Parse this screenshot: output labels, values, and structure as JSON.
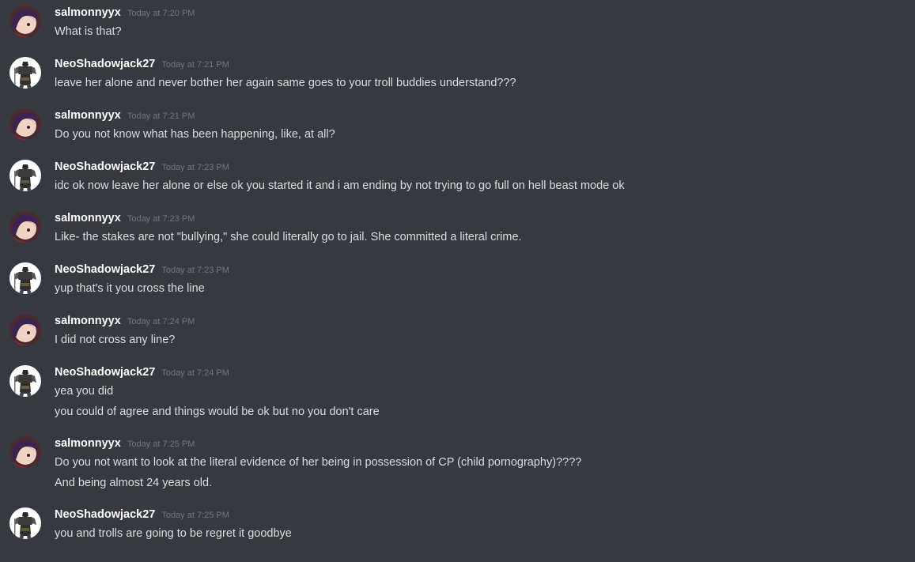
{
  "messages": [
    {
      "author": "salmonnyyx",
      "avatar": "anime-girl-avatar",
      "time": "Today at 7:20 PM",
      "lines": [
        "What is that?"
      ]
    },
    {
      "author": "NeoShadowjack27",
      "avatar": "dark-knight-avatar",
      "time": "Today at 7:21 PM",
      "lines": [
        "leave her alone and never bother her again same goes to your troll buddies understand???"
      ]
    },
    {
      "author": "salmonnyyx",
      "avatar": "anime-girl-avatar",
      "time": "Today at 7:21 PM",
      "lines": [
        "Do you not know what has been happening, like, at all?"
      ]
    },
    {
      "author": "NeoShadowjack27",
      "avatar": "dark-knight-avatar",
      "time": "Today at 7:23 PM",
      "lines": [
        "idc ok now leave her alone or else ok you started it and i am ending by not trying to go full on hell beast mode ok"
      ]
    },
    {
      "author": "salmonnyyx",
      "avatar": "anime-girl-avatar",
      "time": "Today at 7:23 PM",
      "lines": [
        "Like- the stakes are not \"bullying,\" she could literally go to jail. She committed a literal crime."
      ]
    },
    {
      "author": "NeoShadowjack27",
      "avatar": "dark-knight-avatar",
      "time": "Today at 7:23 PM",
      "lines": [
        "yup that's it you cross the line"
      ]
    },
    {
      "author": "salmonnyyx",
      "avatar": "anime-girl-avatar",
      "time": "Today at 7:24 PM",
      "lines": [
        "I did not cross any line?"
      ]
    },
    {
      "author": "NeoShadowjack27",
      "avatar": "dark-knight-avatar",
      "time": "Today at 7:24 PM",
      "lines": [
        "yea you did",
        "you could of agree and things would be ok but no you don't care"
      ]
    },
    {
      "author": "salmonnyyx",
      "avatar": "anime-girl-avatar",
      "time": "Today at 7:25 PM",
      "lines": [
        "Do you not want to look at the literal evidence of her being in possession of CP (child pornography)????",
        "And being almost 24 years old."
      ]
    },
    {
      "author": "NeoShadowjack27",
      "avatar": "dark-knight-avatar",
      "time": "Today at 7:25 PM",
      "lines": [
        "you and trolls are going to be regret it goodbye"
      ]
    }
  ],
  "colors": {
    "background": "#36393f",
    "username": "#ffffff",
    "timestamp": "#72767d",
    "text": "#dcddde"
  }
}
